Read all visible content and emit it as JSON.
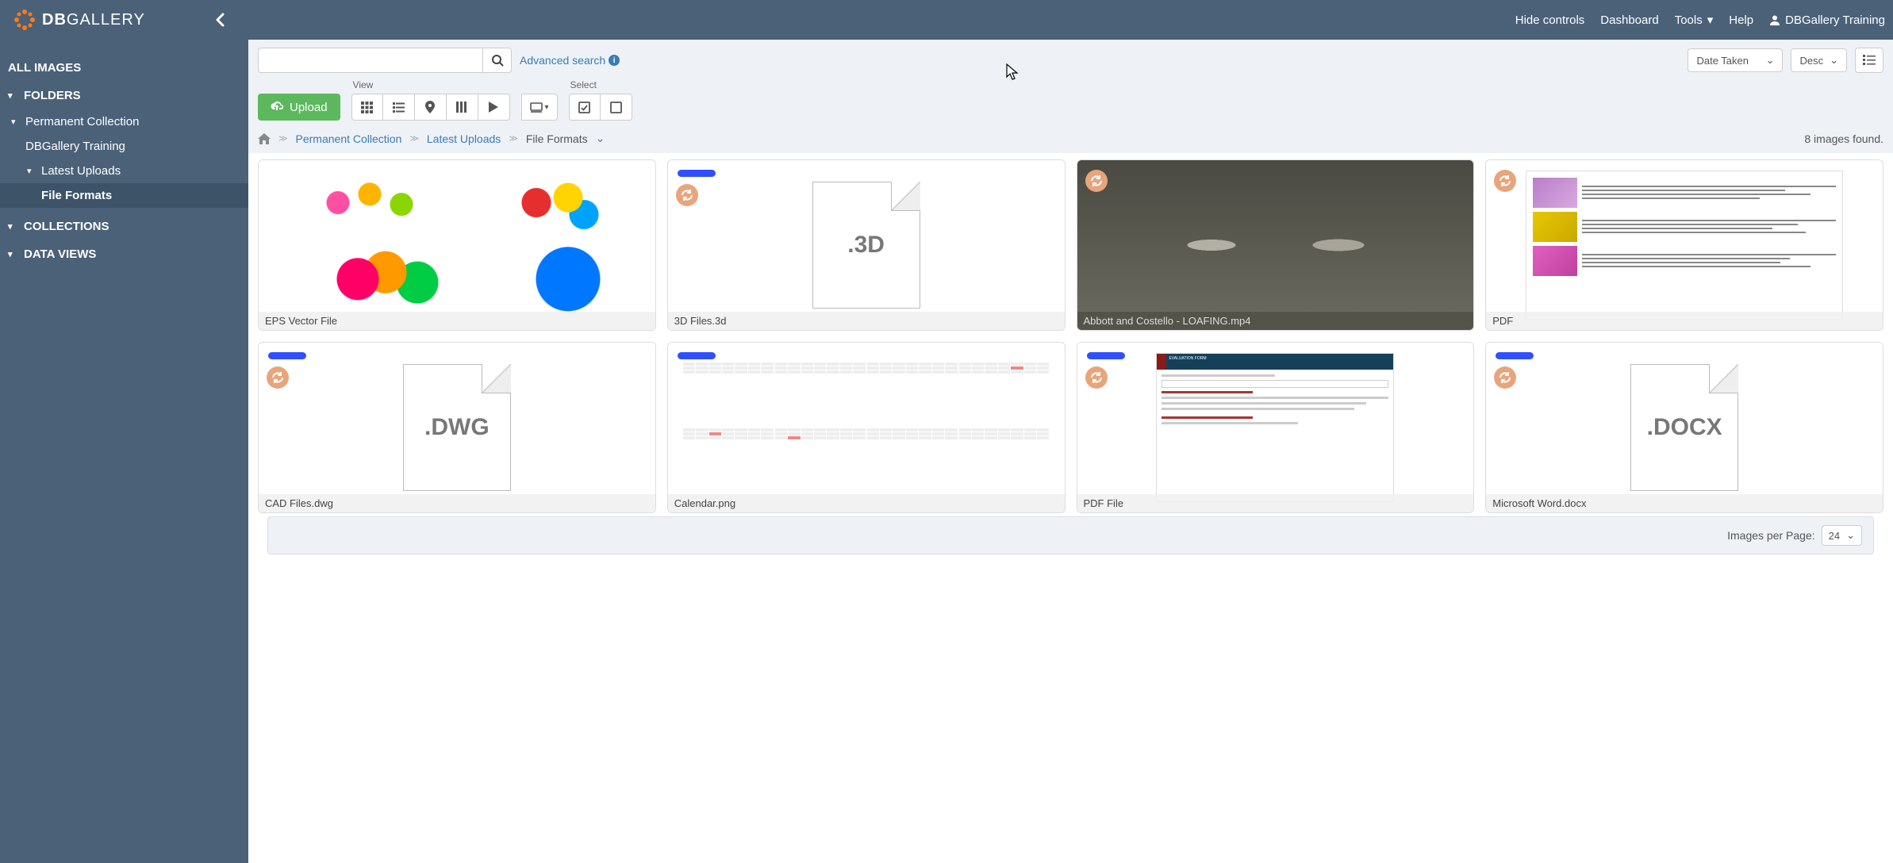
{
  "logo": {
    "text_bold": "DB",
    "text_rest": "GALLERY"
  },
  "topnav": {
    "hide_controls": "Hide controls",
    "dashboard": "Dashboard",
    "tools": "Tools",
    "help": "Help",
    "user": "DBGallery Training"
  },
  "sidebar": {
    "all_images": "ALL IMAGES",
    "folders": "FOLDERS",
    "collections": "COLLECTIONS",
    "data_views": "DATA VIEWS",
    "tree": {
      "permanent": "Permanent Collection",
      "dbgallery_training": "DBGallery Training",
      "latest_uploads": "Latest Uploads",
      "file_formats": "File Formats"
    }
  },
  "toolbar": {
    "advanced_search": "Advanced search",
    "sort_field": "Date Taken",
    "sort_dir": "Desc",
    "upload": "Upload",
    "view_label": "View",
    "select_label": "Select"
  },
  "breadcrumb": {
    "permanent": "Permanent Collection",
    "latest": "Latest Uploads",
    "current": "File Formats",
    "found": "8 images found."
  },
  "cards": [
    {
      "title": "EPS Vector File"
    },
    {
      "title": "3D Files.3d",
      "ext": ".3D"
    },
    {
      "title": "Abbott and Costello - LOAFING.mp4"
    },
    {
      "title": "PDF"
    },
    {
      "title": "CAD Files.dwg",
      "ext": ".DWG"
    },
    {
      "title": "Calendar.png"
    },
    {
      "title": "PDF File"
    },
    {
      "title": "Microsoft Word.docx",
      "ext": ".DOCX"
    }
  ],
  "footer": {
    "per_page_label": "Images per Page:",
    "per_page_value": "24"
  }
}
